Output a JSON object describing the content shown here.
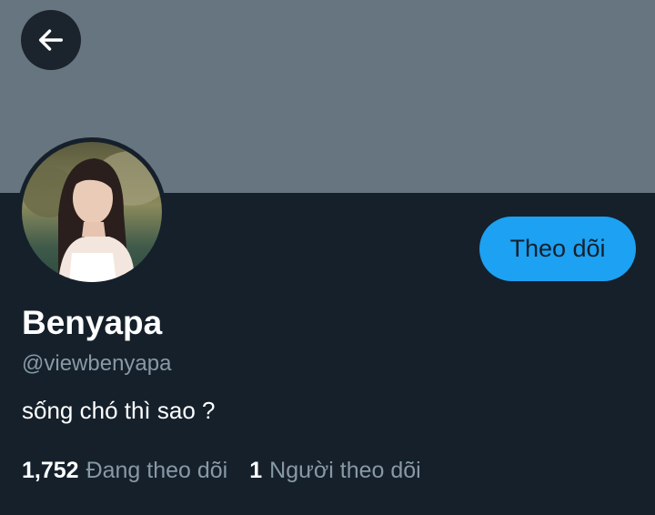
{
  "profile": {
    "display_name": "Benyapa",
    "handle": "@viewbenyapa",
    "bio": "sống chó thì sao ?",
    "follow_label": "Theo dõi",
    "following_count": "1,752",
    "following_label": "Đang theo dõi",
    "followers_count": "1",
    "followers_label": "Người theo dõi"
  },
  "icons": {
    "back": "arrow-left-icon",
    "avatar": "profile-photo"
  },
  "colors": {
    "background": "#15202b",
    "banner": "#66757f",
    "accent": "#1da1f2",
    "secondary_text": "#8899a6"
  }
}
